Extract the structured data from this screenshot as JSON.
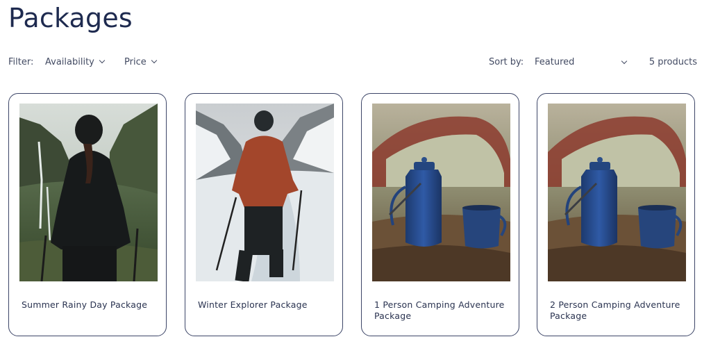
{
  "page": {
    "title": "Packages"
  },
  "filters": {
    "label": "Filter:",
    "availability": "Availability",
    "price": "Price",
    "sort_label": "Sort by:",
    "sort_value": "Featured",
    "count": "5 products"
  },
  "products": [
    {
      "title": "Summer Rainy Day Package"
    },
    {
      "title": "Winter Explorer Package"
    },
    {
      "title": "1 Person Camping Adventure Package"
    },
    {
      "title": "2 Person Camping Adventure Package"
    }
  ]
}
